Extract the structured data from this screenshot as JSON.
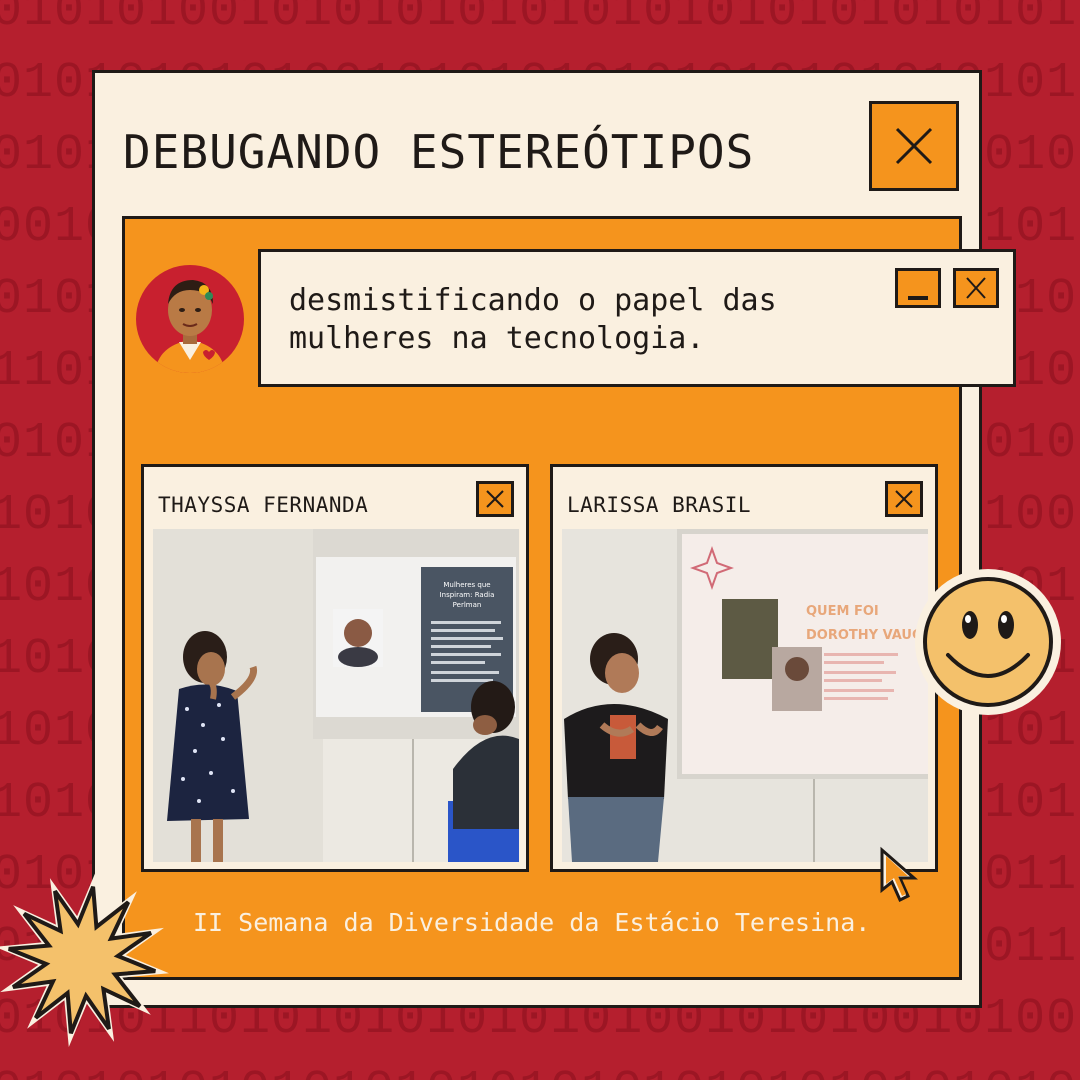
{
  "background": {
    "rows": [
      "0101010010101010101010101010101010101",
      "0101010101001010101010101010101010101",
      "0101010101010101010101010101010101010",
      "0010101010101010101010101010101010101",
      "0101010101010101010101010101010101000",
      "1101010101010101010101010101010101001",
      "0101010101010101010101010101010101010",
      "1010101010101010101010101010101010010",
      "1010101010101010101010101010101010101",
      "1010101010101010101010101010101010101",
      "1010101010101010101010101010101010100",
      "1010101010101010101010101010101010101",
      "0101010101010101010101010101010101101",
      "0101010101010101010101010101010101110",
      "0101011010101010101010010101001010010",
      "0101010101010101010101010101010101010"
    ],
    "colors": {
      "background": "#b51f2e",
      "digits": "#9c1624"
    }
  },
  "window": {
    "title": "DEBUGANDO ESTEREÓTIPOS",
    "close_icon": "close-x-icon"
  },
  "dialog": {
    "text": "desmistificando o papel das mulheres na tecnologia.",
    "minimize_icon": "minimize-icon",
    "close_icon": "close-x-icon"
  },
  "photos": [
    {
      "label": "THAYSSA FERNANDA",
      "close_icon": "close-x-icon",
      "slide_lines": [
        "Mulheres que",
        "Inspiram: Radia",
        "Perlman"
      ]
    },
    {
      "label": "LARISSA BRASIL",
      "close_icon": "close-x-icon",
      "slide_lines": [
        "QUEM FOI",
        "DOROTHY VAUGHAN?"
      ]
    }
  ],
  "footer": "II Semana da Diversidade da Estácio Teresina.",
  "decorations": {
    "smiley": "smiley-face-icon",
    "cursor": "pixel-cursor-icon",
    "starburst": "starburst-icon",
    "avatar": "woman-avatar-icon"
  },
  "colors": {
    "cream": "#faf0e0",
    "orange": "#f5941d",
    "ink": "#1f1a17",
    "red": "#b51f2e"
  }
}
